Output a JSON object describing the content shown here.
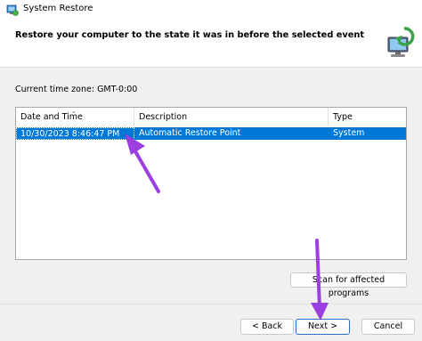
{
  "window": {
    "title": "System Restore",
    "icon": "system-restore-icon"
  },
  "header": {
    "text": "Restore your computer to the state it was in before the selected event",
    "logo_icon": "computer-restore-logo-icon"
  },
  "timezone_label": "Current time zone: GMT-0:00",
  "table": {
    "columns": [
      "Date and Time",
      "Description",
      "Type"
    ],
    "rows": [
      {
        "date_time": "10/30/2023 8:46:47 PM",
        "description": "Automatic Restore Point",
        "type": "System",
        "selected": true
      }
    ]
  },
  "buttons": {
    "scan": "Scan for affected programs",
    "back": "< Back",
    "next": "Next >",
    "cancel": "Cancel"
  },
  "colors": {
    "selection": "#0078d7",
    "annotation_arrow": "#9b3fe0"
  }
}
